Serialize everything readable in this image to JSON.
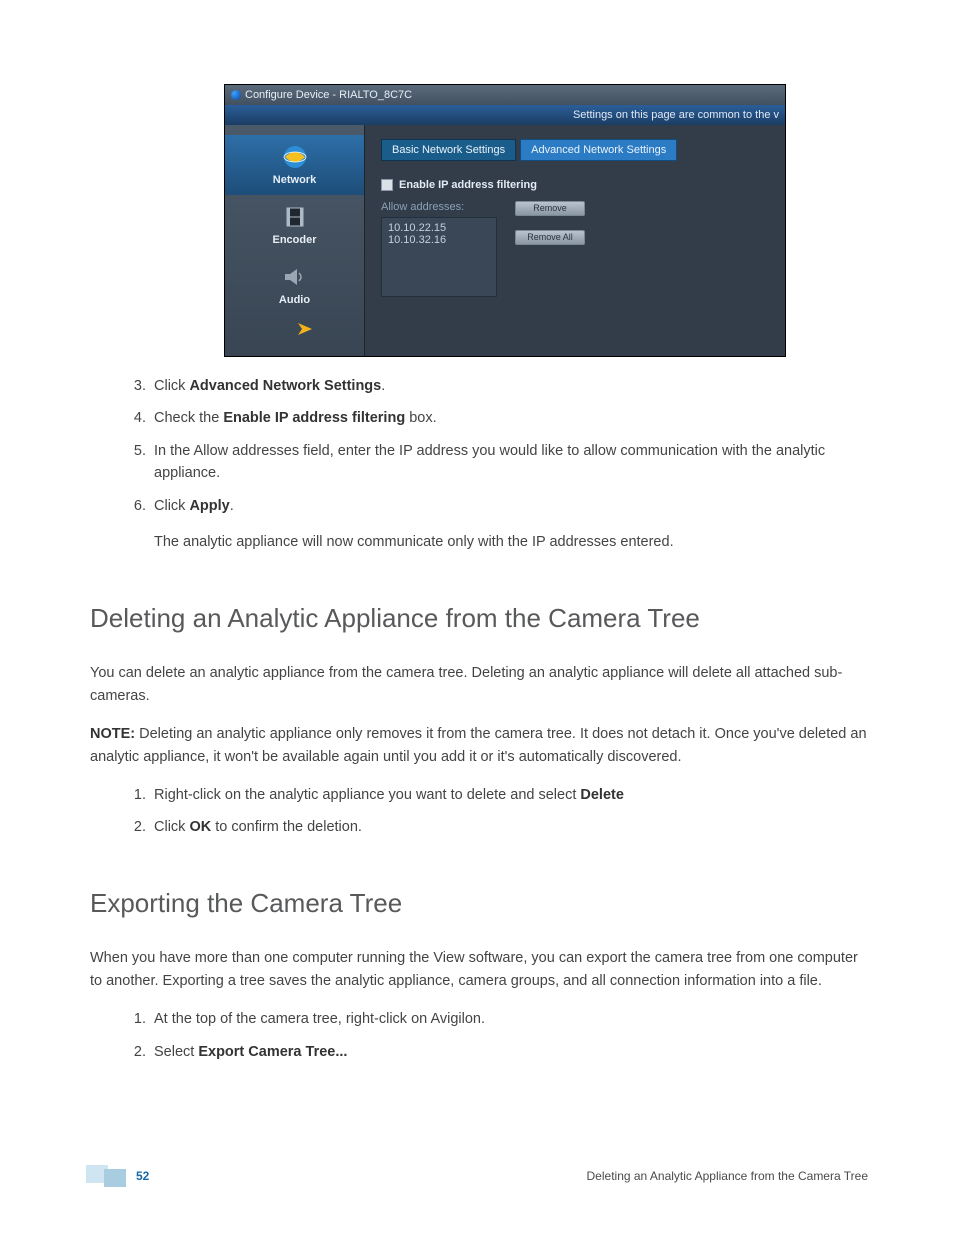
{
  "screenshot": {
    "window_title": "Configure Device - RIALTO_8C7C",
    "banner": "Settings on this page are common to the v",
    "sidebar": [
      {
        "label": "Network",
        "icon": "globe-icon",
        "selected": true
      },
      {
        "label": "Encoder",
        "icon": "film-icon",
        "selected": false
      },
      {
        "label": "Audio",
        "icon": "speaker-icon",
        "selected": false
      }
    ],
    "tabs": {
      "basic": "Basic Network Settings",
      "advanced": "Advanced Network Settings"
    },
    "checkbox_label": "Enable IP address filtering",
    "allow_label": "Allow addresses:",
    "ips": [
      "10.10.22.15",
      "10.10.32.16"
    ],
    "buttons": {
      "remove": "Remove",
      "remove_all": "Remove All"
    }
  },
  "doc": {
    "steps_a": {
      "s3_pre": "Click ",
      "s3_bold": "Advanced Network Settings",
      "s3_post": ".",
      "s4_pre": "Check the ",
      "s4_bold": "Enable IP address filtering",
      "s4_post": " box.",
      "s5": "In the Allow addresses field, enter the IP address you would like to allow communication with the analytic appliance.",
      "s6_pre": "Click ",
      "s6_bold": "Apply",
      "s6_post": ".",
      "s6_follow": "The analytic appliance will now communicate only with the IP addresses entered."
    },
    "h_delete": "Deleting an Analytic Appliance from the Camera Tree",
    "p_delete": "You can delete an analytic appliance from the camera tree. Deleting an analytic appliance will delete all attached sub-cameras.",
    "note_label": "NOTE:",
    "note_text": " Deleting an analytic appliance only removes it from the camera tree. It does not detach it. Once you've deleted an analytic appliance, it won't be available again until you add it or it's automatically discovered.",
    "steps_b": {
      "s1_pre": "Right-click on the analytic appliance you want to delete and select ",
      "s1_bold": "Delete",
      "s2_pre": "Click ",
      "s2_bold": "OK",
      "s2_post": " to confirm the deletion."
    },
    "h_export": "Exporting the Camera Tree",
    "p_export": "When you have more than one computer running the View software, you can export the camera tree from one computer to another. Exporting a tree saves the analytic appliance, camera groups, and all connection information into a file.",
    "steps_c": {
      "s1": "At the top of the camera tree, right-click on Avigilon.",
      "s2_pre": "Select ",
      "s2_bold": "Export Camera Tree..."
    }
  },
  "footer": {
    "page": "52",
    "title": "Deleting an Analytic Appliance from the Camera Tree"
  }
}
